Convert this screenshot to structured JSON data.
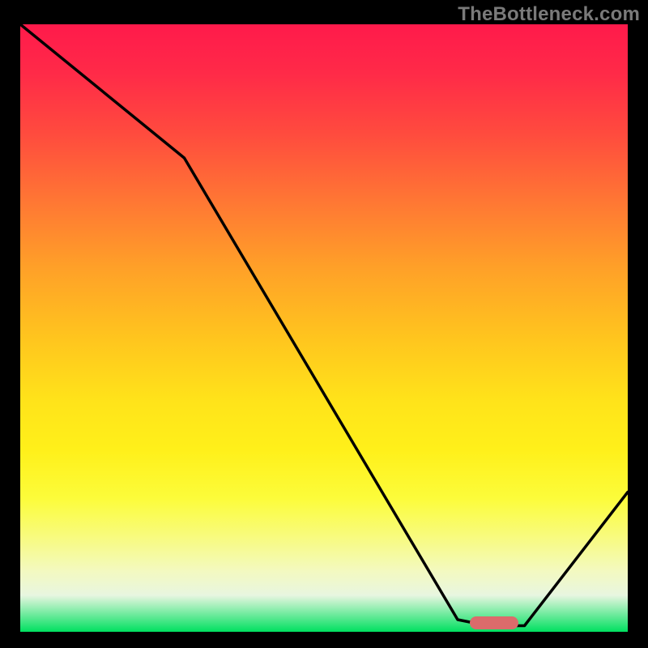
{
  "watermark": "TheBottleneck.com",
  "chart_data": {
    "type": "line",
    "title": "",
    "xlabel": "",
    "ylabel": "",
    "xlim": [
      0,
      100
    ],
    "ylim": [
      0,
      100
    ],
    "x": [
      0,
      27,
      72,
      77,
      83,
      100
    ],
    "values": [
      100,
      78,
      2,
      1,
      1,
      23
    ],
    "gradient_stops": [
      {
        "pos": 0,
        "color": "#ff1a4b"
      },
      {
        "pos": 50,
        "color": "#ffc61e"
      },
      {
        "pos": 80,
        "color": "#fcfc3a"
      },
      {
        "pos": 100,
        "color": "#00e060"
      }
    ],
    "marker": {
      "x_start": 74,
      "x_end": 82,
      "y": 1.5,
      "color": "#db6b6b"
    }
  }
}
